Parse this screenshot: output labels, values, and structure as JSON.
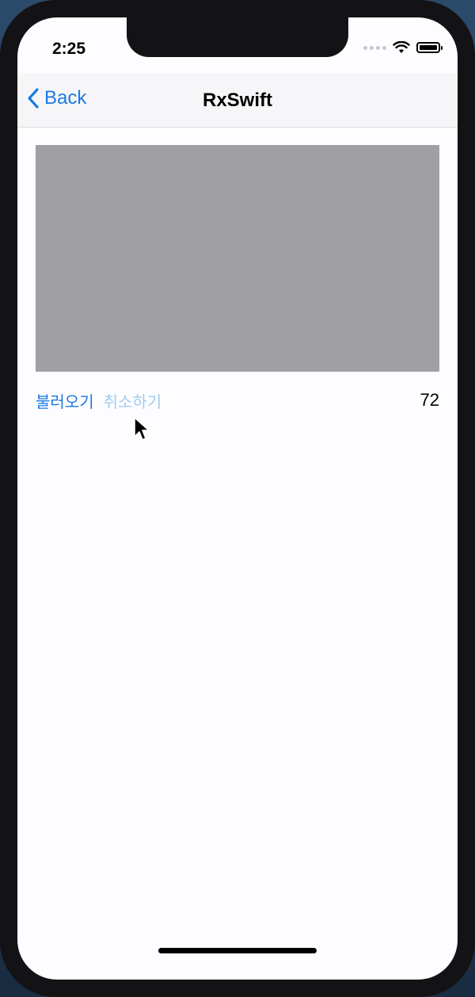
{
  "status_bar": {
    "time": "2:25"
  },
  "navigation": {
    "back_label": "Back",
    "title": "RxSwift"
  },
  "controls": {
    "load_label": "불러오기",
    "cancel_label": "취소하기",
    "count": "72"
  },
  "colors": {
    "accent": "#1a7ae3",
    "disabled_accent": "#9fcdee",
    "image_placeholder": "#a09fa3",
    "navbar_background": "#f6f6f8"
  },
  "icons": {
    "back": "chevron-left-icon",
    "wifi": "wifi-icon",
    "battery": "battery-icon",
    "signal": "cellular-signal-icon"
  }
}
